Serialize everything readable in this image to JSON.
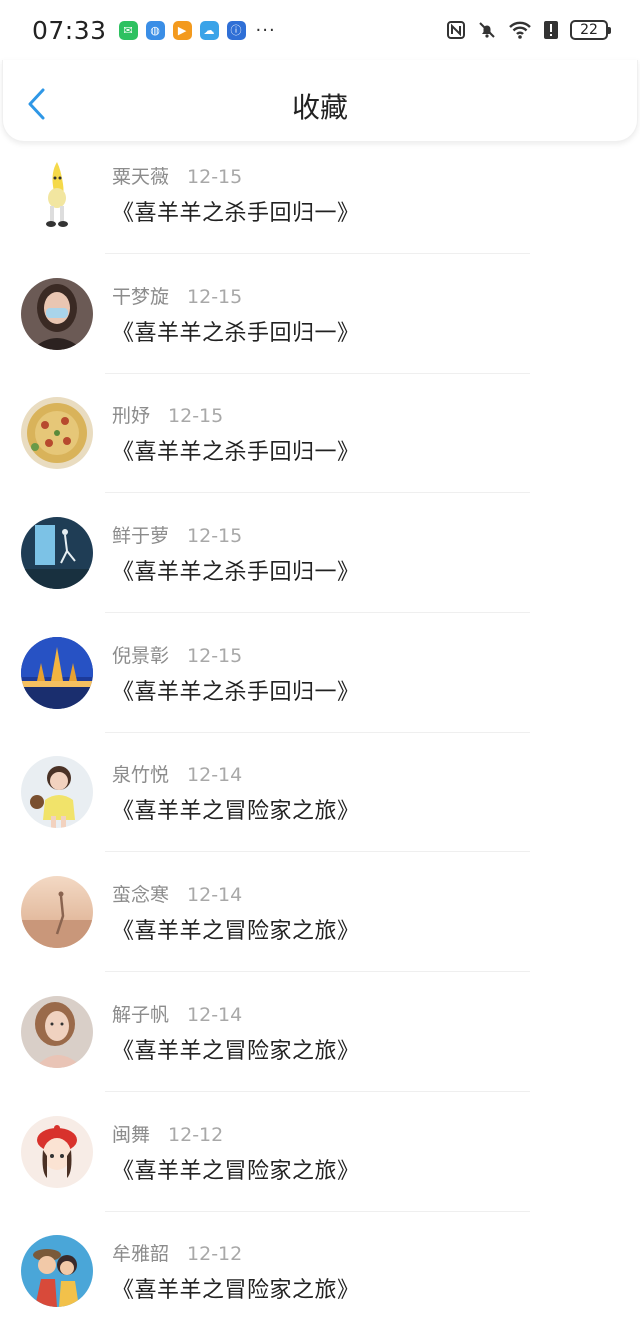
{
  "status_bar": {
    "time": "07:33",
    "more": "···",
    "battery": "22",
    "app_icons": [
      {
        "name": "wechat-icon",
        "color": "#2dc160",
        "glyph": "✉"
      },
      {
        "name": "browser-icon",
        "color": "#3a8ee6",
        "glyph": "◍"
      },
      {
        "name": "video-player-icon",
        "color": "#f39a1e",
        "glyph": "▶"
      },
      {
        "name": "weather-cloud-icon",
        "color": "#3aa3e8",
        "glyph": "☁"
      },
      {
        "name": "lightbulb-icon",
        "color": "#2f6fd6",
        "glyph": "ⓘ"
      }
    ]
  },
  "header": {
    "title": "收藏",
    "accent_color": "#2e97e6"
  },
  "items": [
    {
      "name": "粟天薇",
      "date": "12-15",
      "title": "《喜羊羊之杀手回归一》",
      "avatar": "avatar-banana"
    },
    {
      "name": "干梦旋",
      "date": "12-15",
      "title": "《喜羊羊之杀手回归一》",
      "avatar": "avatar-girl-mask"
    },
    {
      "name": "刑妤",
      "date": "12-15",
      "title": "《喜羊羊之杀手回归一》",
      "avatar": "avatar-pizza"
    },
    {
      "name": "鲜于萝",
      "date": "12-15",
      "title": "《喜羊羊之杀手回归一》",
      "avatar": "avatar-dancer"
    },
    {
      "name": "倪景彰",
      "date": "12-15",
      "title": "《喜羊羊之杀手回归一》",
      "avatar": "avatar-temple"
    },
    {
      "name": "泉竹悦",
      "date": "12-14",
      "title": "《喜羊羊之冒险家之旅》",
      "avatar": "avatar-child"
    },
    {
      "name": "蛮念寒",
      "date": "12-14",
      "title": "《喜羊羊之冒险家之旅》",
      "avatar": "avatar-sunset"
    },
    {
      "name": "解子帆",
      "date": "12-14",
      "title": "《喜羊羊之冒险家之旅》",
      "avatar": "avatar-woman"
    },
    {
      "name": "闽舞",
      "date": "12-12",
      "title": "《喜羊羊之冒险家之旅》",
      "avatar": "avatar-cartoon-girl"
    },
    {
      "name": "牟雅韶",
      "date": "12-12",
      "title": "《喜羊羊之冒险家之旅》",
      "avatar": "avatar-anime"
    }
  ]
}
